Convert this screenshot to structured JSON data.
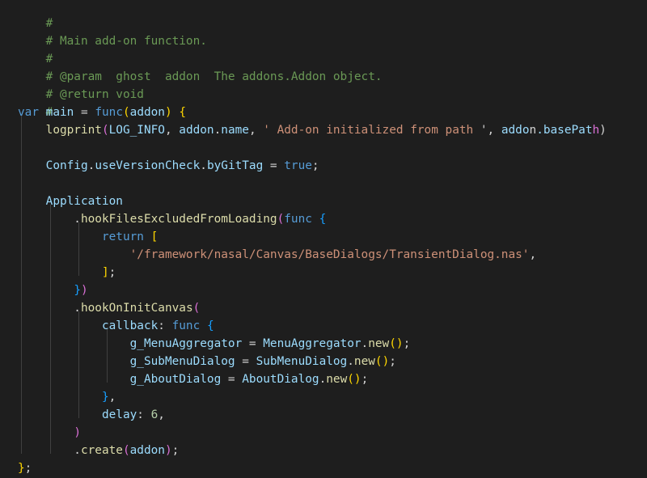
{
  "code_lines": [
    "#",
    "# Main add-on function.",
    "#",
    "# @param  ghost  addon  The addons.Addon object.",
    "# @return void",
    "#",
    "var main = func(addon) {",
    "    logprint(LOG_INFO, addon.name, ' Add-on initialized from path ', addon.basePath);",
    "",
    "    Config.useVersionCheck.byGitTag = true;",
    "",
    "    Application",
    "        .hookFilesExcludedFromLoading(func {",
    "            return [",
    "                '/framework/nasal/Canvas/BaseDialogs/TransientDialog.nas',",
    "            ];",
    "        })",
    "        .hookOnInitCanvas(",
    "            callback: func {",
    "                g_MenuAggregator = MenuAggregator.new();",
    "                g_SubMenuDialog = SubMenuDialog.new();",
    "                g_AboutDialog = AboutDialog.new();",
    "            },",
    "            delay: 6,",
    "        )",
    "        .create(addon);",
    "};"
  ],
  "colors": {
    "background": "#1e1e1e",
    "comment": "#6a9955",
    "keyword": "#569cd6",
    "function": "#dcdcaa",
    "variable": "#9cdcfe",
    "string": "#ce9178",
    "number": "#b5cea8",
    "bracket_level1": "#ffd700",
    "bracket_level2": "#da70d6",
    "bracket_level3": "#179fff"
  }
}
